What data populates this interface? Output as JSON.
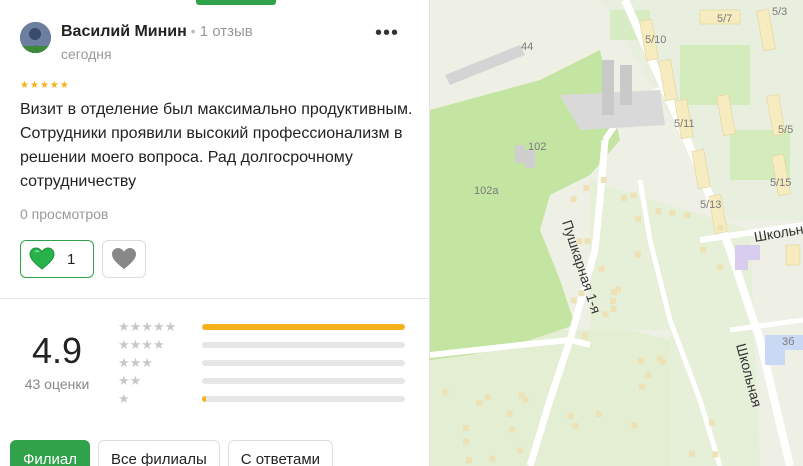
{
  "review": {
    "author": "Василий Минин",
    "review_count": "1 отзыв",
    "date": "сегодня",
    "rating": 5,
    "text": "Визит в отделение был максимально продуктивным. Сотрудники проявили высокий профессионализм в решении моего вопроса. Рад долгосрочному сотрудничеству",
    "views": "0 просмотров",
    "likes": "1",
    "more_label": "•••"
  },
  "rating_summary": {
    "score": "4.9",
    "count_label": "43 оценки",
    "distribution": [
      {
        "stars": 5,
        "fraction": 1.0
      },
      {
        "stars": 4,
        "fraction": 0.0
      },
      {
        "stars": 3,
        "fraction": 0.0
      },
      {
        "stars": 2,
        "fraction": 0.0
      },
      {
        "stars": 1,
        "fraction": 0.02
      }
    ]
  },
  "tabs": [
    {
      "label": "Филиал",
      "active": true
    },
    {
      "label": "Все филиалы",
      "active": false
    },
    {
      "label": "С ответами",
      "active": false
    }
  ],
  "map": {
    "street_labels": [
      "Пушкарная 1-я",
      "Школьная",
      "Школьн"
    ],
    "building_labels": [
      "5/3",
      "5/7",
      "5/10",
      "44",
      "5/11",
      "5/5",
      "102",
      "102a",
      "5/15",
      "5/13",
      "3б"
    ]
  },
  "colors": {
    "accent": "#2fa24a",
    "star": "#f5b21d",
    "map_green": "#c6e6a4",
    "map_bg": "#eef1e6"
  },
  "icons": {
    "like": "green-heart-icon",
    "dislike": "grey-heart-icon",
    "more": "more-dots-icon"
  }
}
